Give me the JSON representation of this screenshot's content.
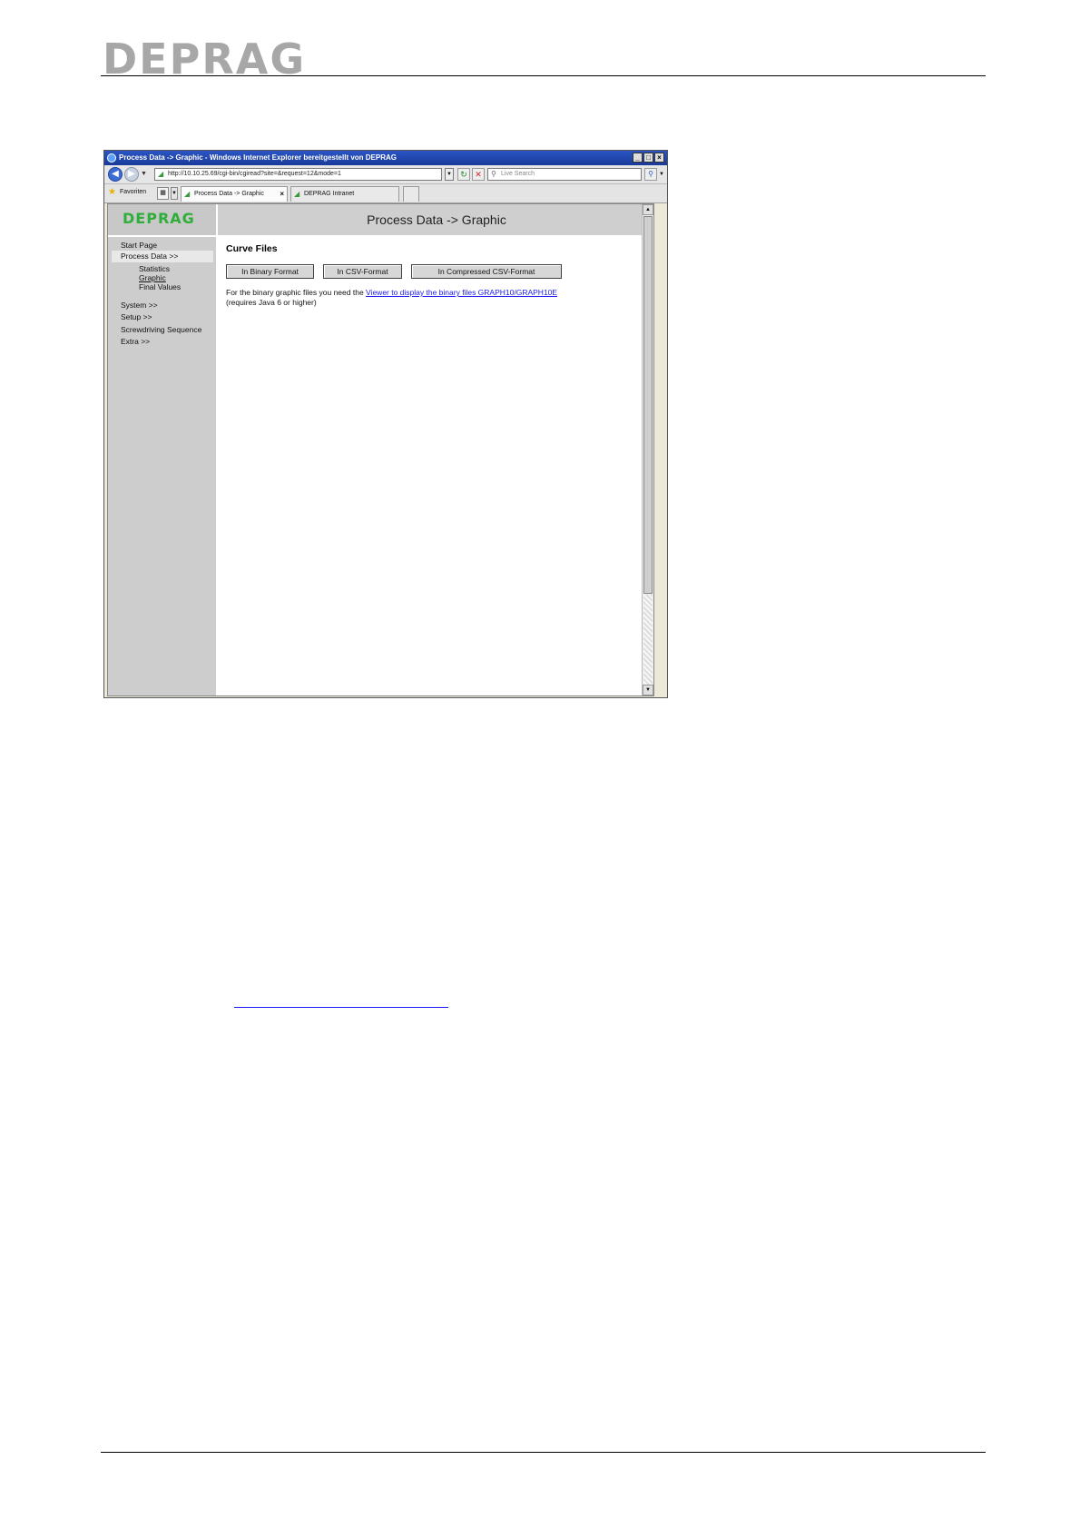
{
  "document": {
    "logo_text": "DEPRAG"
  },
  "browser": {
    "window_title": "Process Data -> Graphic - Windows Internet Explorer bereitgestellt von DEPRAG",
    "window_buttons": [
      "_",
      "□",
      "×"
    ],
    "address_url": "http://10.10.25.69/cgi-bin/cgiread?site=&request=12&mode=1",
    "search_placeholder": "Live Search",
    "favorites_label": "Favoriten",
    "tabs": [
      {
        "label": "Process Data -> Graphic",
        "active": true,
        "close": "×"
      },
      {
        "label": "DEPRAG Intranet",
        "active": false
      }
    ]
  },
  "site": {
    "logo_text": "DEPRAG",
    "logo_color": "#2fae3b",
    "header_title": "Process Data -> Graphic",
    "nav": {
      "start_page": "Start Page",
      "process_data": "Process Data >>",
      "statistics": "Statistics",
      "graphic": "Graphic",
      "final_values": "Final Values",
      "system": "System >>",
      "setup": "Setup >>",
      "screwdriving_sequence": "Screwdriving Sequence",
      "extra": "Extra >>"
    },
    "content": {
      "section_title": "Curve Files",
      "btn_binary": "In Binary Format",
      "btn_csv": "In CSV-Format",
      "btn_compressed": "In Compressed CSV-Format",
      "info_prefix": "For the binary graphic files you need the ",
      "info_link": "Viewer to display the binary files GRAPH10/GRAPH10E",
      "info_line2": "(requires Java 6 or higher)"
    }
  }
}
